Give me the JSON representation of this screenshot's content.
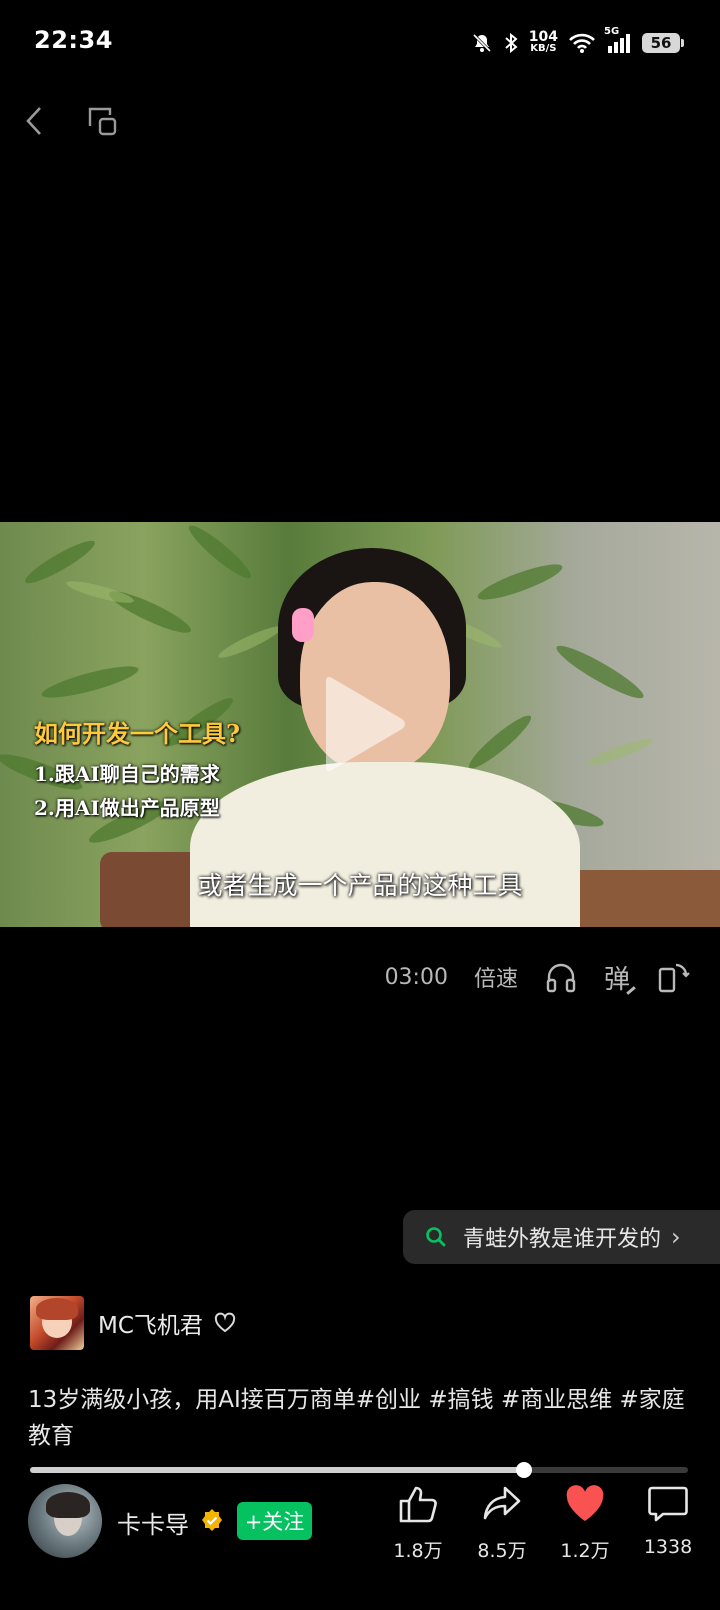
{
  "status_bar": {
    "time": "22:34",
    "net_speed_value": "104",
    "net_speed_unit": "KB/S",
    "signal_label": "5G",
    "battery": "56",
    "icons": [
      "mute-bell-icon",
      "bluetooth-icon",
      "wifi-icon",
      "cell-signal-icon",
      "battery-icon"
    ]
  },
  "nav": {
    "icons": [
      "back-icon",
      "mini-window-icon"
    ]
  },
  "video": {
    "overlay_title": "如何开发一个工具?",
    "overlay_line1": "1.跟AI聊自己的需求",
    "overlay_line2": "2.用AI做出产品原型",
    "subtitle": "或者生成一个产品的这种工具",
    "colors": {
      "overlay_title": "#ffc93c"
    }
  },
  "controls": {
    "duration": "03:00",
    "speed_label": "倍速",
    "danmu_label": "弹",
    "icons": [
      "headphones-icon",
      "rotate-screen-icon"
    ]
  },
  "search_chip": {
    "text": "青蛙外教是谁开发的",
    "chevron": "›"
  },
  "channel": {
    "name": "MC飞机君"
  },
  "description": "13岁满级小孩，用AI接百万商单#创业 #搞钱 #商业思维 #家庭教育",
  "progress": {
    "fraction": 0.75
  },
  "author": {
    "name": "卡卡导",
    "follow_label": "+关注"
  },
  "actions": {
    "like_count": "1.8万",
    "share_count": "8.5万",
    "favorite_count": "1.2万",
    "comment_count": "1338",
    "colors": {
      "favorite": "#fa5151",
      "follow": "#06c160"
    }
  }
}
